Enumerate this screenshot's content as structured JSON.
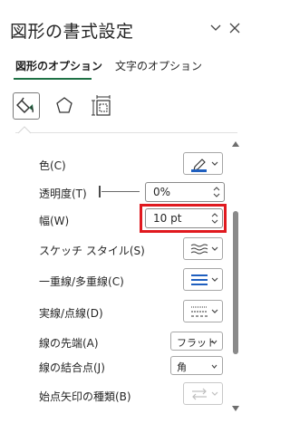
{
  "pane": {
    "title": "図形の書式設定",
    "dropdown_icon": "chevron-down-icon",
    "close_icon": "close-icon"
  },
  "tabs": [
    {
      "label": "図形のオプション",
      "active": true
    },
    {
      "label": "文字のオプション",
      "active": false
    }
  ],
  "icon_tabs": [
    {
      "icon": "fill-bucket-icon",
      "active": true
    },
    {
      "icon": "pentagon-effects-icon",
      "active": false
    },
    {
      "icon": "size-properties-icon",
      "active": false
    }
  ],
  "properties": {
    "color": {
      "label": "色(C)",
      "icon": "pen-color-icon",
      "accent": "#1f5fbf"
    },
    "transparency": {
      "label": "透明度(T)",
      "value": "0%",
      "slider_level": 0
    },
    "width": {
      "label": "幅(W)",
      "value": "10 pt"
    },
    "sketch_style": {
      "label": "スケッチ スタイル(S)",
      "icon": "sketch-style-icon"
    },
    "compound_type": {
      "label": "一重線/多重線(C)",
      "icon": "compound-lines-icon"
    },
    "dash_type": {
      "label": "実線/点線(D)",
      "icon": "dash-lines-icon"
    },
    "cap_type": {
      "label": "線の先端(A)",
      "value": "フラット"
    },
    "join_type": {
      "label": "線の結合点(J)",
      "value": "角"
    },
    "begin_arrow_type": {
      "label": "始点矢印の種類(B)",
      "icon": "arrow-type-icon"
    }
  },
  "colors": {
    "accent_green": "#1e7145",
    "highlight_red": "#e0191f",
    "icon_blue": "#1f5fbf"
  }
}
